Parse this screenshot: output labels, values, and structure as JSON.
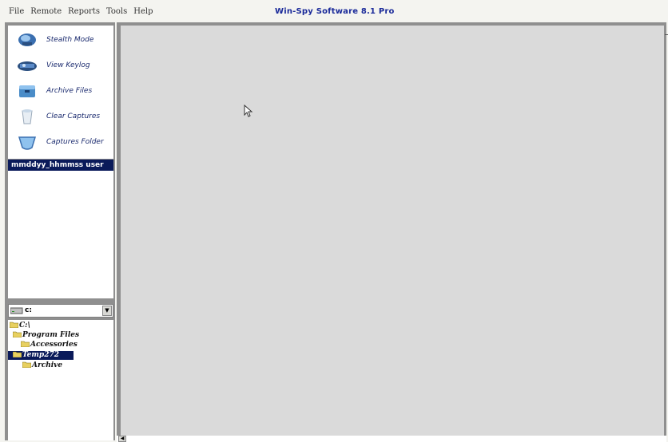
{
  "menu": {
    "items": [
      "File",
      "Remote",
      "Reports",
      "Tools",
      "Help"
    ]
  },
  "app": {
    "title": "Win-Spy Software 8.1 Pro"
  },
  "tools": [
    {
      "label": "Stealth Mode",
      "icon": "stealth-mode-icon"
    },
    {
      "label": "View Keylog",
      "icon": "keylog-icon"
    },
    {
      "label": "Archive Files",
      "icon": "archive-files-icon"
    },
    {
      "label": "Clear Captures",
      "icon": "clear-captures-icon"
    },
    {
      "label": "Captures Folder",
      "icon": "captures-folder-icon"
    }
  ],
  "captures": {
    "selected": "mmddyy_hhmmss user"
  },
  "drive": {
    "value": "c:"
  },
  "tree": [
    {
      "label": "C:\\",
      "selected": false
    },
    {
      "label": "Program Files",
      "selected": false
    },
    {
      "label": "Accessories",
      "selected": false
    },
    {
      "label": "Temp272",
      "selected": true
    },
    {
      "label": "Archive",
      "selected": false
    }
  ],
  "colors": {
    "title": "#1a2a9a",
    "selection": "#0a1a5a",
    "panel_border": "#8f8f8f",
    "viewer_bg": "#dadada"
  }
}
